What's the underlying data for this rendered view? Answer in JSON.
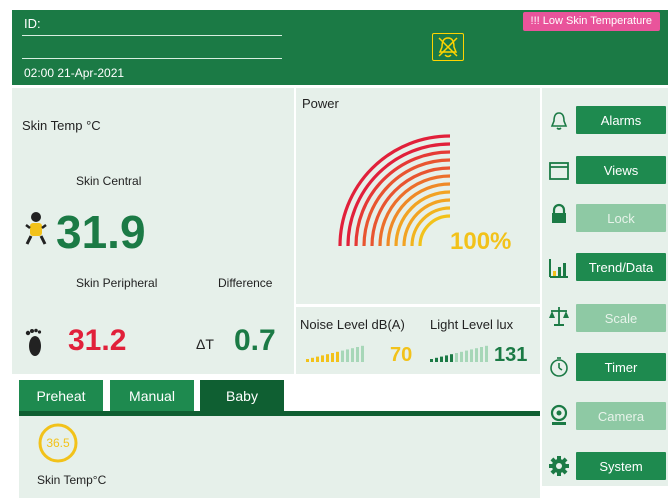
{
  "header": {
    "id_label": "ID:",
    "datetime": "02:00 21-Apr-2021",
    "alert": "!!! Low Skin Temperature",
    "alarm_silenced_icon": "bell-off-icon"
  },
  "skin_temp": {
    "title": "Skin Temp °C",
    "central_label": "Skin Central",
    "central_value": "31.9",
    "peripheral_label": "Skin Peripheral",
    "peripheral_value": "31.2",
    "difference_label": "Difference",
    "delta_symbol": "ΔT",
    "difference_value": "0.7"
  },
  "power": {
    "title": "Power",
    "value_text": "100%",
    "level_percent": 100
  },
  "ambient": {
    "noise_label": "Noise Level dB(A)",
    "noise_value": "70",
    "light_label": "Light Level lux",
    "light_value": "131"
  },
  "sidebar": {
    "alarms": "Alarms",
    "views": "Views",
    "lock": "Lock",
    "trend": "Trend/Data",
    "scale": "Scale",
    "timer": "Timer",
    "camera": "Camera",
    "system": "System"
  },
  "tabs": {
    "preheat": "Preheat",
    "manual": "Manual",
    "baby": "Baby"
  },
  "baby_panel": {
    "setpoint_value": "36.5",
    "setpoint_label": "Skin Temp°C"
  },
  "colors": {
    "brand_green": "#1e8a4f",
    "alert_pink": "#e9549b",
    "value_green": "#1b7a45",
    "value_red": "#e1203a",
    "yellow": "#f2c21a"
  }
}
